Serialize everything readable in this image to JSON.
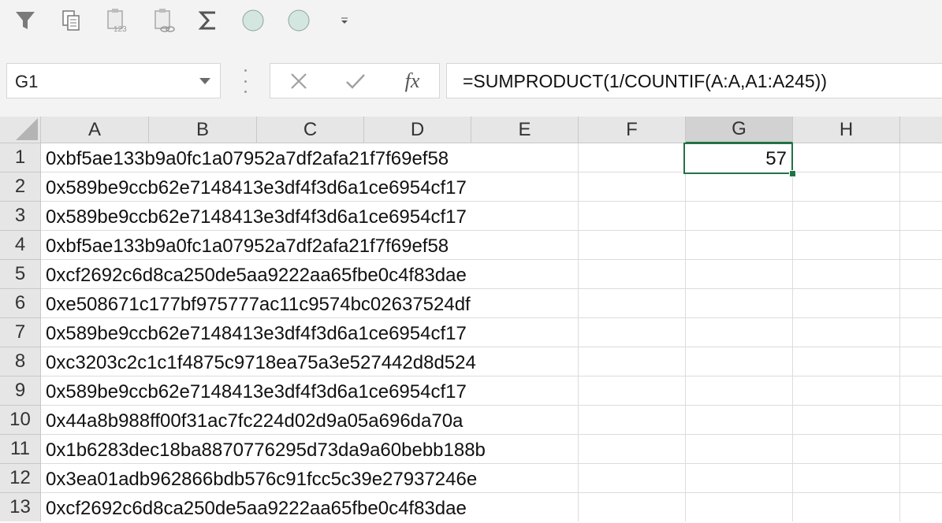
{
  "toolbar": {
    "icons": [
      "filter-icon",
      "copy-icon",
      "paste-values-icon",
      "paste-link-icon",
      "autosum-icon",
      "circle-icon",
      "circle-icon",
      "customize-qat-icon"
    ]
  },
  "namebox": {
    "value": "G1"
  },
  "formula_bar": {
    "cancel_symbol": "✕",
    "enter_symbol": "✓",
    "fx_label": "fx",
    "formula": "=SUMPRODUCT(1/COUNTIF(A:A,A1:A245))"
  },
  "columns": [
    "A",
    "B",
    "C",
    "D",
    "E",
    "F",
    "G",
    "H"
  ],
  "rows": [
    "1",
    "2",
    "3",
    "4",
    "5",
    "6",
    "7",
    "8",
    "9",
    "10",
    "11",
    "12",
    "13"
  ],
  "column_a_values": [
    "0xbf5ae133b9a0fc1a07952a7df2afa21f7f69ef58",
    "0x589be9ccb62e7148413e3df4f3d6a1ce6954cf17",
    "0x589be9ccb62e7148413e3df4f3d6a1ce6954cf17",
    "0xbf5ae133b9a0fc1a07952a7df2afa21f7f69ef58",
    "0xcf2692c6d8ca250de5aa9222aa65fbe0c4f83dae",
    "0xe508671c177bf975777ac11c9574bc02637524df",
    "0x589be9ccb62e7148413e3df4f3d6a1ce6954cf17",
    "0xc3203c2c1c1f4875c9718ea75a3e527442d8d524",
    "0x589be9ccb62e7148413e3df4f3d6a1ce6954cf17",
    "0x44a8b988ff00f31ac7fc224d02d9a05a696da70a",
    "0x1b6283dec18ba8870776295d73da9a60bebb188b",
    "0x3ea01adb962866bdb576c91fcc5c39e27937246e",
    "0xcf2692c6d8ca250de5aa9222aa65fbe0c4f83dae"
  ],
  "selected_cell": {
    "address": "G1",
    "value": "57"
  },
  "colors": {
    "accent": "#217346",
    "header_bg": "#e6e6e6",
    "toolbar_bg": "#f3f3f3",
    "gridline": "#dcdcdc"
  }
}
